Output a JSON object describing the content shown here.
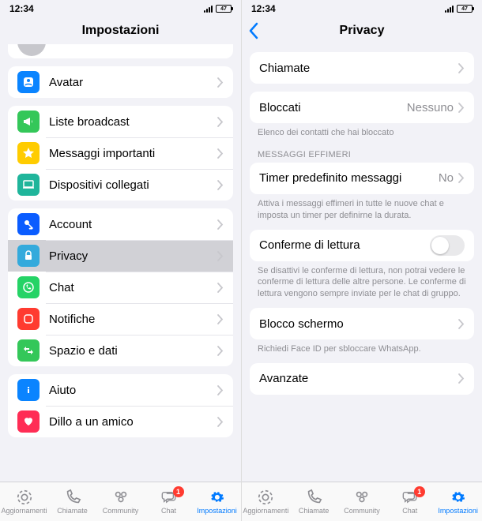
{
  "status": {
    "time": "12:34",
    "battery": "47"
  },
  "screen1": {
    "title": "Impostazioni",
    "g0": {
      "avatar": "Avatar"
    },
    "g1": {
      "broadcast": "Liste broadcast",
      "starred": "Messaggi importanti",
      "linked": "Dispositivi collegati"
    },
    "g2": {
      "account": "Account",
      "privacy": "Privacy",
      "chat": "Chat",
      "notif": "Notifiche",
      "storage": "Spazio e dati"
    },
    "g3": {
      "help": "Aiuto",
      "tell": "Dillo a un amico"
    }
  },
  "screen2": {
    "title": "Privacy",
    "calls": "Chiamate",
    "blocked": {
      "label": "Bloccati",
      "value": "Nessuno",
      "footer": "Elenco dei contatti che hai bloccato"
    },
    "ephemeral": {
      "header": "MESSAGGI EFFIMERI",
      "timer_label": "Timer predefinito messaggi",
      "timer_value": "No",
      "footer": "Attiva i messaggi effimeri in tutte le nuove chat e imposta un timer per definirne la durata."
    },
    "readreceipt": {
      "label": "Conferme di lettura",
      "footer": "Se disattivi le conferme di lettura, non potrai vedere le conferme di lettura delle altre persone. Le conferme di lettura vengono sempre inviate per le chat di gruppo."
    },
    "screenlock": {
      "label": "Blocco schermo",
      "footer": "Richiedi Face ID per sbloccare WhatsApp."
    },
    "advanced": "Avanzate"
  },
  "tabs": {
    "updates": "Aggiornamenti",
    "calls": "Chiamate",
    "community": "Community",
    "chat": "Chat",
    "chat_badge": "1",
    "settings": "Impostazioni"
  }
}
